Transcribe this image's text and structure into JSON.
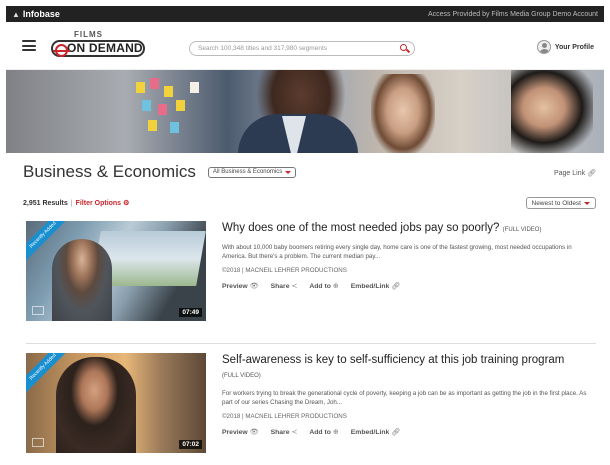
{
  "topbar": {
    "brand": "Infobase",
    "access": "Access Provided by Films Media Group Demo Account"
  },
  "header": {
    "logo_top": "FILMS",
    "logo_main": "ON DEMAND",
    "search_placeholder": "Search 100,348 titles and 317,980 segments",
    "profile_label": "Your Profile"
  },
  "page": {
    "title": "Business & Economics",
    "category_select": "All Business & Economics",
    "page_link": "Page Link",
    "results_count": "2,951 Results",
    "filter_options": "Filter Options",
    "sort": "Newest to Oldest"
  },
  "results": [
    {
      "title": "Why does one of the most needed jobs pay so poorly?",
      "tag": "(FULL VIDEO)",
      "description": "With about 10,000 baby boomers retiring every single day, home care is one of the fastest growing, most needed occupations in America. But there's a problem. The current median pay...",
      "meta": "©2018 | MACNEIL LEHRER PRODUCTIONS",
      "duration": "07:49",
      "badge": "Recently Added",
      "actions": {
        "preview": "Preview",
        "share": "Share",
        "add": "Add to",
        "embed": "Embed/Link"
      }
    },
    {
      "title": "Self-awareness is key to self-sufficiency at this job training program",
      "tag": "(FULL VIDEO)",
      "description": "For workers trying to break the generational cycle of poverty, keeping a job can be as important as getting the job in the first place. As part of our series Chasing the Dream, Joh...",
      "meta": "©2018 | MACNEIL LEHRER PRODUCTIONS",
      "duration": "07:02",
      "badge": "Recently Added",
      "actions": {
        "preview": "Preview",
        "share": "Share",
        "add": "Add to",
        "embed": "Embed/Link"
      }
    }
  ],
  "colors": {
    "accent": "#c8262b",
    "topbar": "#222222",
    "badge": "#1a8fd0"
  }
}
